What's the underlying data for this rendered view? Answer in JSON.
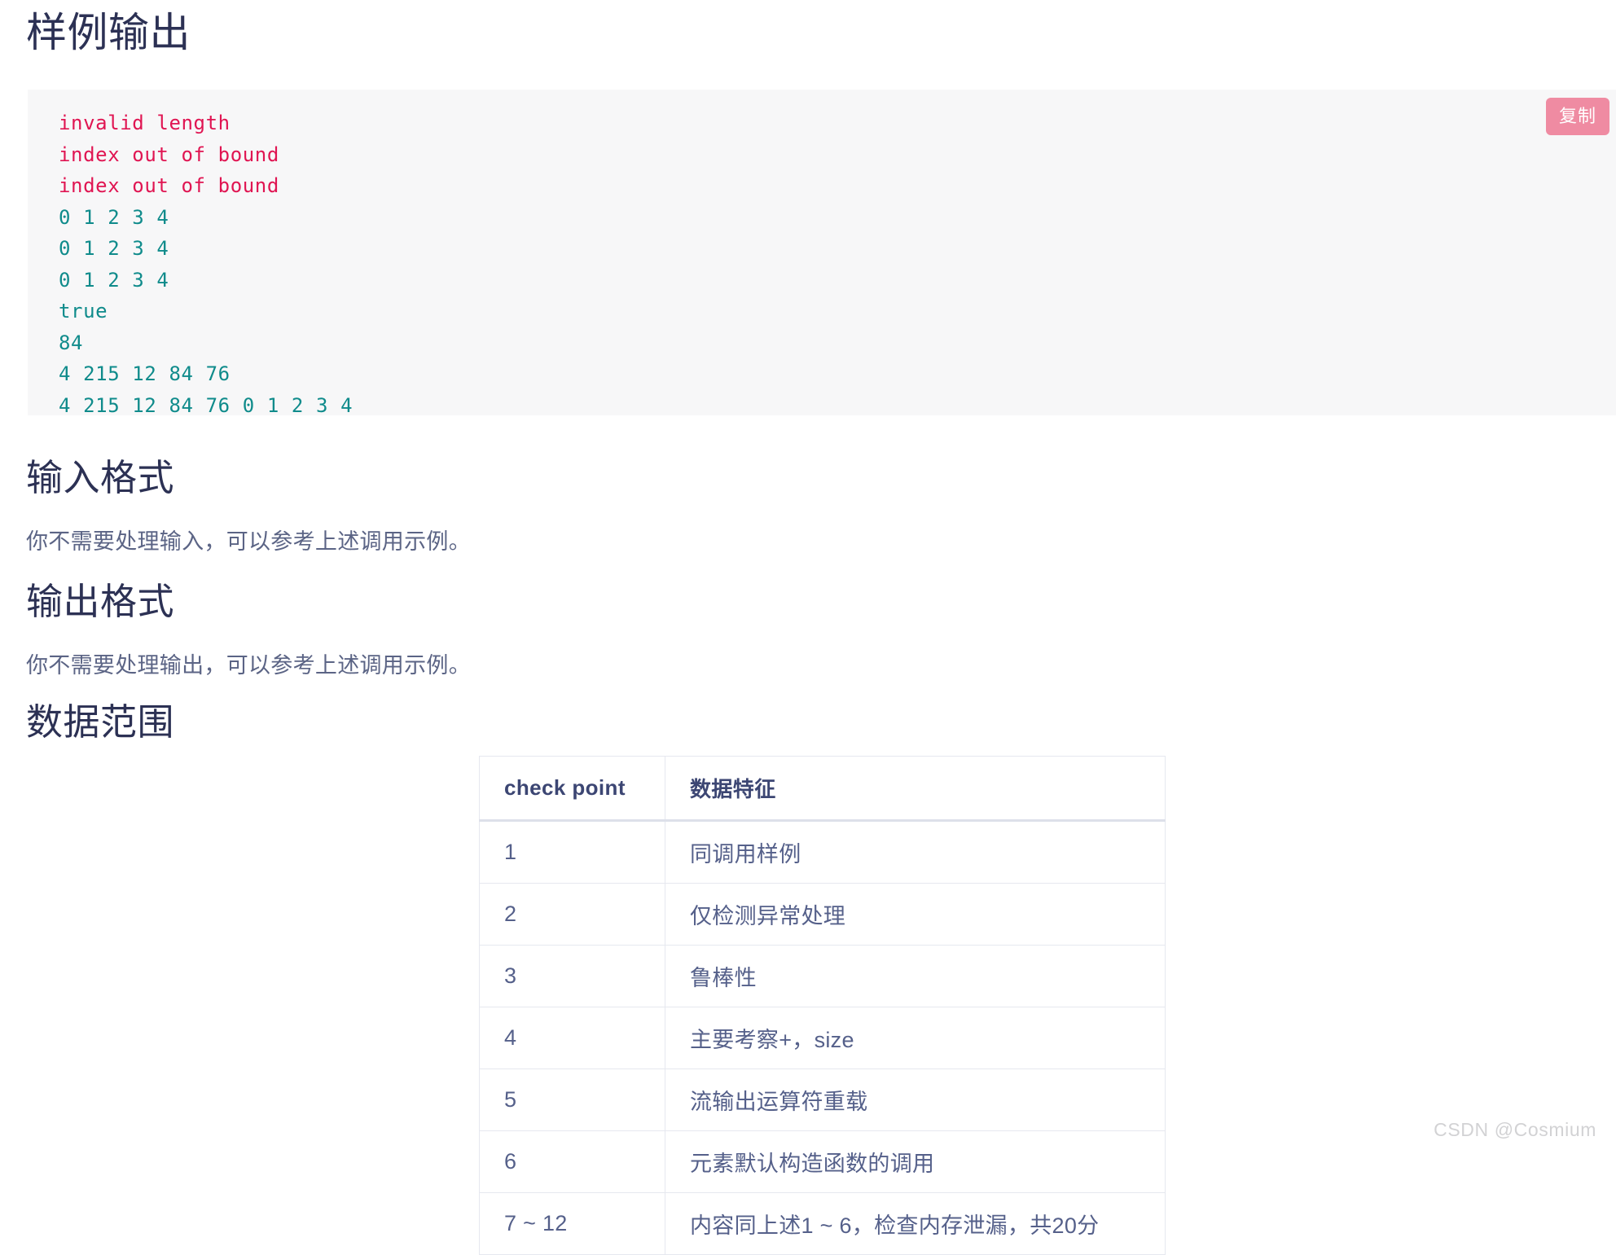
{
  "sections": {
    "sample_output_heading": "样例输出",
    "input_format_heading": "输入格式",
    "input_format_text": "你不需要处理输入，可以参考上述调用示例。",
    "output_format_heading": "输出格式",
    "output_format_text": "你不需要处理输出，可以参考上述调用示例。",
    "data_range_heading": "数据范围"
  },
  "code_block": {
    "copy_button_label": "复制",
    "background_color": "#f7f7f8",
    "error_color": "#e01552",
    "output_color": "#0f8b8b",
    "lines": [
      {
        "text": "invalid length",
        "kind": "err"
      },
      {
        "text": "index out of bound",
        "kind": "err"
      },
      {
        "text": "index out of bound",
        "kind": "err"
      },
      {
        "text": "0 1 2 3 4",
        "kind": "out"
      },
      {
        "text": "0 1 2 3 4",
        "kind": "out"
      },
      {
        "text": "0 1 2 3 4",
        "kind": "out"
      },
      {
        "text": "true",
        "kind": "out"
      },
      {
        "text": "84",
        "kind": "out"
      },
      {
        "text": "4 215 12 84 76",
        "kind": "out"
      },
      {
        "text": "4 215 12 84 76 0 1 2 3 4",
        "kind": "out"
      }
    ]
  },
  "range_table": {
    "headers": [
      "check point",
      "数据特征"
    ],
    "rows": [
      [
        "1",
        "同调用样例"
      ],
      [
        "2",
        "仅检测异常处理"
      ],
      [
        "3",
        "鲁棒性"
      ],
      [
        "4",
        "主要考察+，size"
      ],
      [
        "5",
        "流输出运算符重载"
      ],
      [
        "6",
        "元素默认构造函数的调用"
      ],
      [
        "7 ~ 12",
        "内容同上述1 ~ 6，检查内存泄漏，共20分"
      ]
    ]
  },
  "watermark": {
    "text": "CSDN @Cosmium"
  },
  "colors": {
    "heading": "#2c3154",
    "body_text": "#5b6485",
    "table_header_text": "#3c4673",
    "table_cell_text": "#55608a",
    "table_border": "#e6e8ef",
    "copy_button_bg": "#ef8ba2",
    "watermark": "#d2d2d4"
  }
}
